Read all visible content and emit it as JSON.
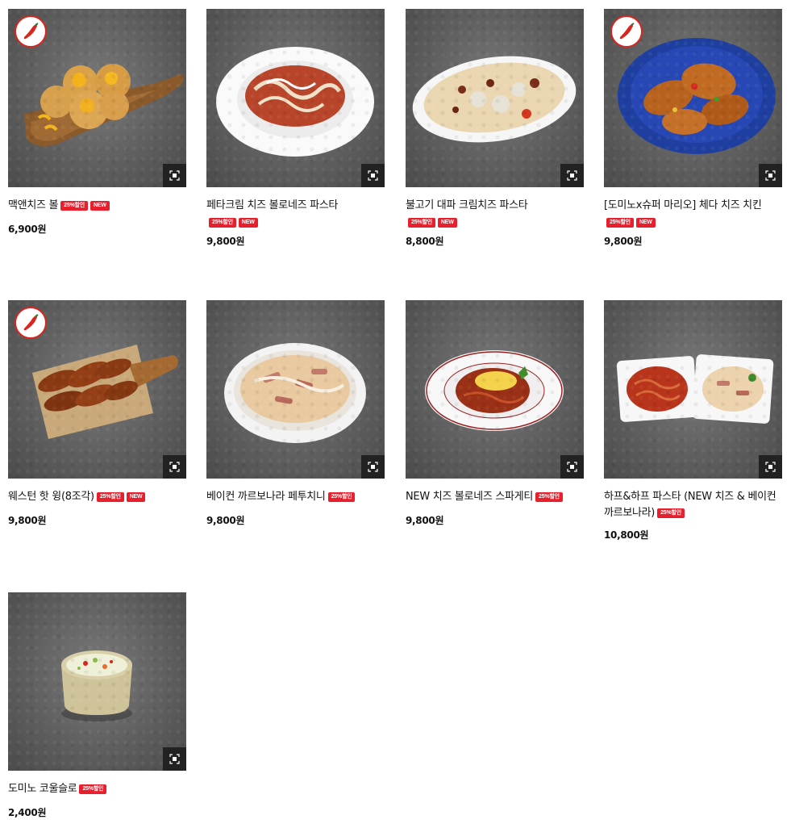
{
  "badges": {
    "discount": "25%할인",
    "new": "NEW"
  },
  "products": [
    {
      "name": "맥앤치즈 볼",
      "price": "6,900원",
      "spicy": true,
      "discount": true,
      "is_new": true
    },
    {
      "name": "페타크림 치즈 볼로네즈 파스타",
      "price": "9,800원",
      "spicy": false,
      "discount": true,
      "is_new": true
    },
    {
      "name": "불고기 대파 크림치즈 파스타",
      "price": "8,800원",
      "spicy": false,
      "discount": true,
      "is_new": true
    },
    {
      "name": "[도미노x슈퍼 마리오] 체다 치즈 치킨",
      "price": "9,800원",
      "spicy": true,
      "discount": true,
      "is_new": true
    },
    {
      "name": "웨스턴 핫 윙(8조각)",
      "price": "9,800원",
      "spicy": true,
      "discount": true,
      "is_new": true
    },
    {
      "name": "베이컨 까르보나라 페투치니",
      "price": "9,800원",
      "spicy": false,
      "discount": true,
      "is_new": false
    },
    {
      "name": "NEW 치즈 볼로네즈 스파게티",
      "price": "9,800원",
      "spicy": false,
      "discount": true,
      "is_new": false
    },
    {
      "name_line1": "하프&하프 파스타 (NEW 치즈 & 베이컨",
      "name_line2": "까르보나라)",
      "price": "10,800원",
      "spicy": false,
      "discount": true,
      "is_new": false
    },
    {
      "name": "도미노 코울슬로",
      "price": "2,400원",
      "spicy": false,
      "discount": true,
      "is_new": false
    }
  ],
  "colors": {
    "badge_red": "#e8202e",
    "spicy_ring": "#d9251d",
    "zoom_bg": "#222222"
  },
  "icons": {
    "spicy": "chili-pepper-icon",
    "zoom": "zoom-expand-icon"
  }
}
